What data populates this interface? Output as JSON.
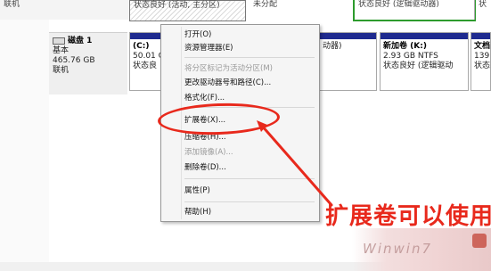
{
  "top_row": {
    "left_label": "联机",
    "partition1_status": "状态良好 (活动, 主分区)",
    "partition2_status": "未分配",
    "partition3_status": "状态良好 (逻辑驱动器)",
    "partition4_status": "状"
  },
  "disk": {
    "name": "磁盘 1",
    "type": "基本",
    "size": "465.76 GB",
    "state": "联机"
  },
  "partitions": [
    {
      "name": "(C:)",
      "size": "50.01 G",
      "status": "状态良"
    },
    {
      "name": "",
      "size": "",
      "status": "动器)"
    },
    {
      "name": "新加卷 (K:)",
      "size": "2.93 GB NTFS",
      "status": "状态良好 (逻辑驱动"
    },
    {
      "name": "文档",
      "size": "139",
      "status": "状态"
    }
  ],
  "context_menu": {
    "open": "打开(O)",
    "explorer": "资源管理器(E)",
    "mark_active": "将分区标记为活动分区(M)",
    "change_letter": "更改驱动器号和路径(C)...",
    "format": "格式化(F)...",
    "extend": "扩展卷(X)...",
    "shrink": "压缩卷(H)...",
    "add_mirror": "添加镜像(A)...",
    "delete": "删除卷(D)...",
    "properties": "属性(P)",
    "help": "帮助(H)"
  },
  "annotation": {
    "text": "扩展卷可以使用",
    "color": "#e8291c"
  },
  "watermark": {
    "text": "Winwin7"
  },
  "colors": {
    "partition_bar": "#1f2b8f",
    "logical_border": "#2d9b2d",
    "menu_background": "#f5f5f5"
  }
}
